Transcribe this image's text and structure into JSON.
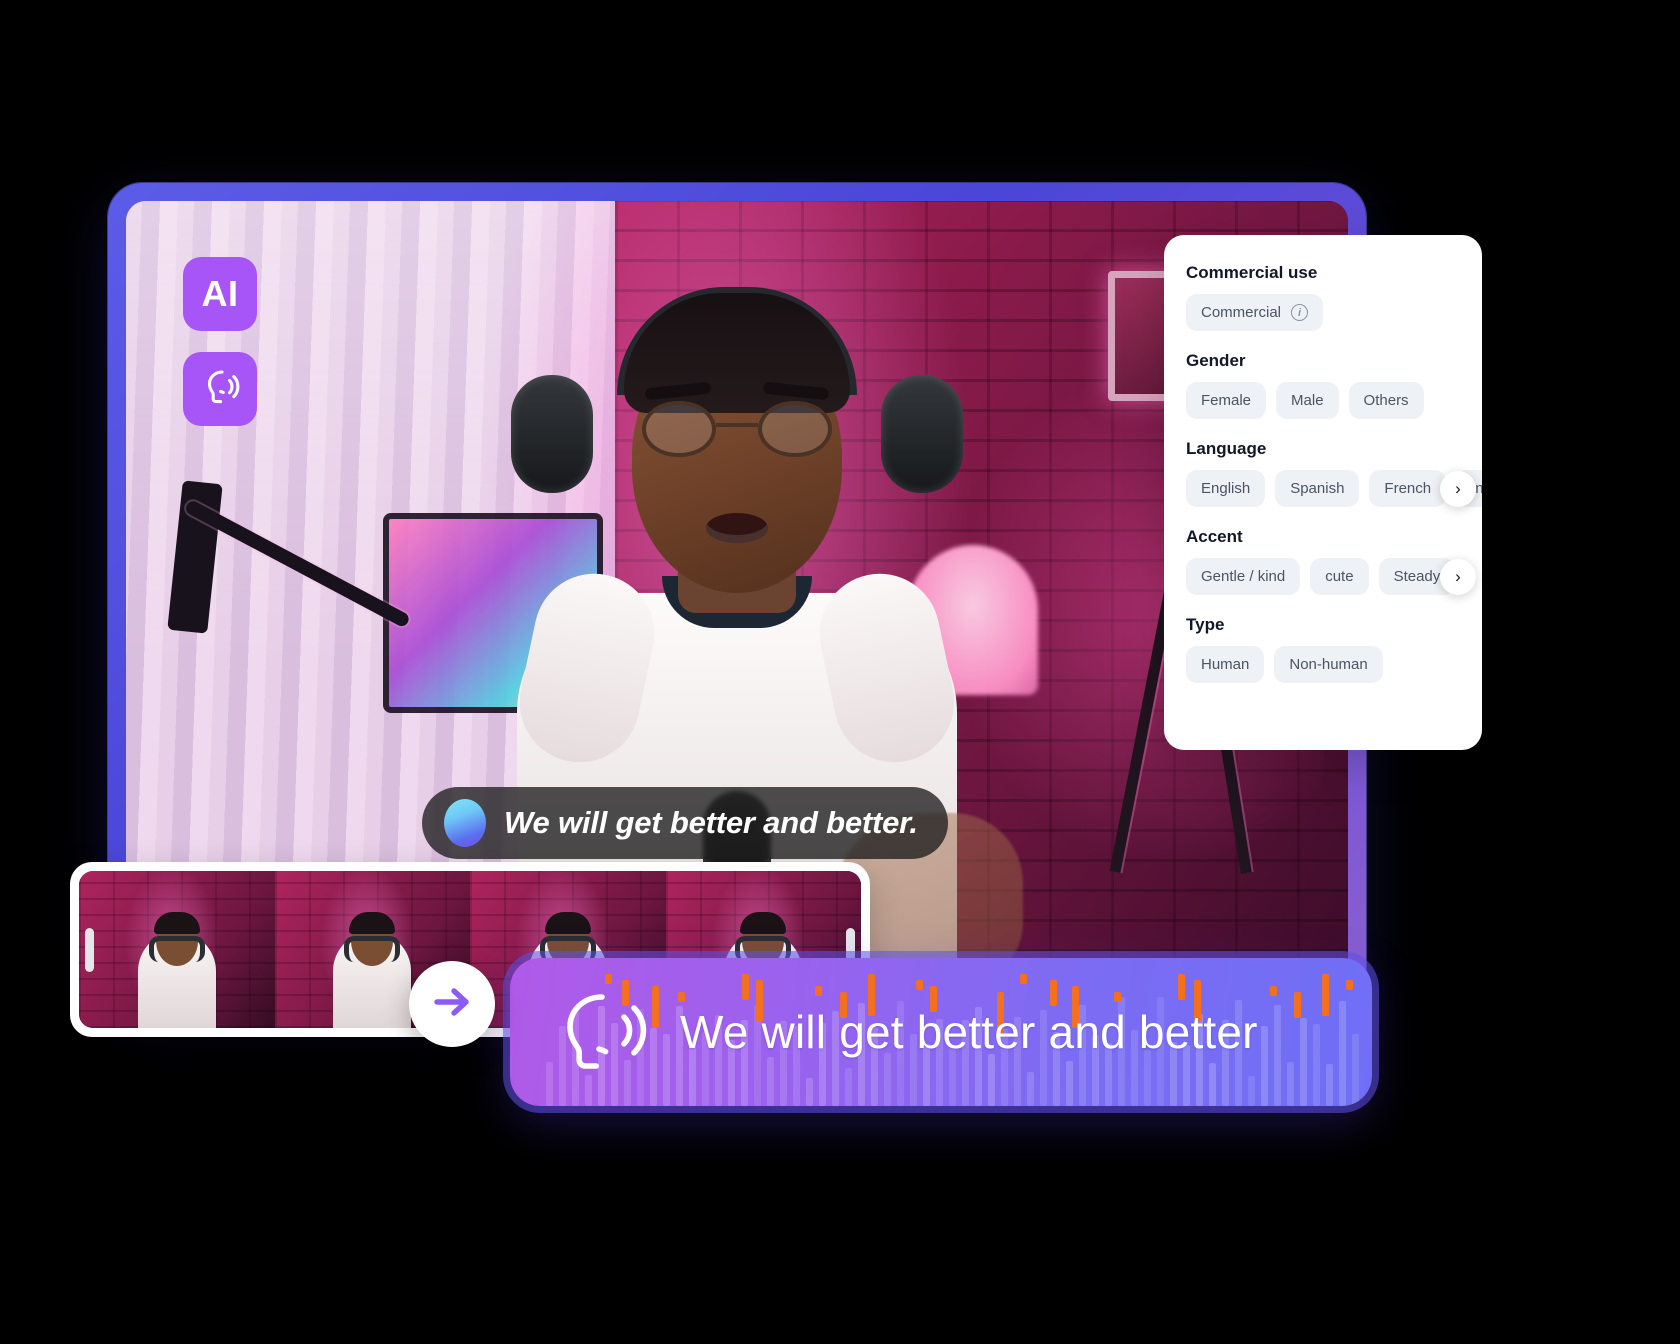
{
  "video_card": {
    "ai_badge_label": "AI",
    "voice_badge_icon": "head-speaking-icon",
    "caption_text": "We will get better and better.",
    "caption_orb_icon": "ai-orb-icon"
  },
  "options_panel": {
    "groups": [
      {
        "title": "Commercial use",
        "chips": [
          "Commercial"
        ],
        "has_info_icon": true,
        "has_next_arrow": false
      },
      {
        "title": "Gender",
        "chips": [
          "Female",
          "Male",
          "Others"
        ],
        "has_info_icon": false,
        "has_next_arrow": false
      },
      {
        "title": "Language",
        "chips": [
          "English",
          "Spanish",
          "French",
          "In"
        ],
        "has_info_icon": false,
        "has_next_arrow": true
      },
      {
        "title": "Accent",
        "chips": [
          "Gentle / kind",
          "cute",
          "Steady"
        ],
        "has_info_icon": false,
        "has_next_arrow": true
      },
      {
        "title": "Type",
        "chips": [
          "Human",
          "Non-human"
        ],
        "has_info_icon": false,
        "has_next_arrow": false
      }
    ],
    "info_icon_glyph": "i",
    "next_arrow_glyph": "›"
  },
  "filmstrip": {
    "frame_count": 4,
    "label": "video-timeline-thumbnails"
  },
  "arrow_button": {
    "icon": "arrow-right-icon",
    "accent_color": "#8b5cf6"
  },
  "audio_bar": {
    "text": "We will get better and better",
    "icon": "head-speaking-icon",
    "wave_accent_color": "#f2701f",
    "gradient_from": "#b05ae8",
    "gradient_to": "#6f6ff5"
  },
  "colors": {
    "badge_purple": "#a855f7",
    "card_border": "#4f46e5",
    "chip_bg": "#eef1f5",
    "chip_text": "#4b5563",
    "panel_bg": "#ffffff",
    "title_text": "#111827",
    "caption_bg": "rgba(30,30,30,0.78)",
    "page_bg": "#000000"
  }
}
